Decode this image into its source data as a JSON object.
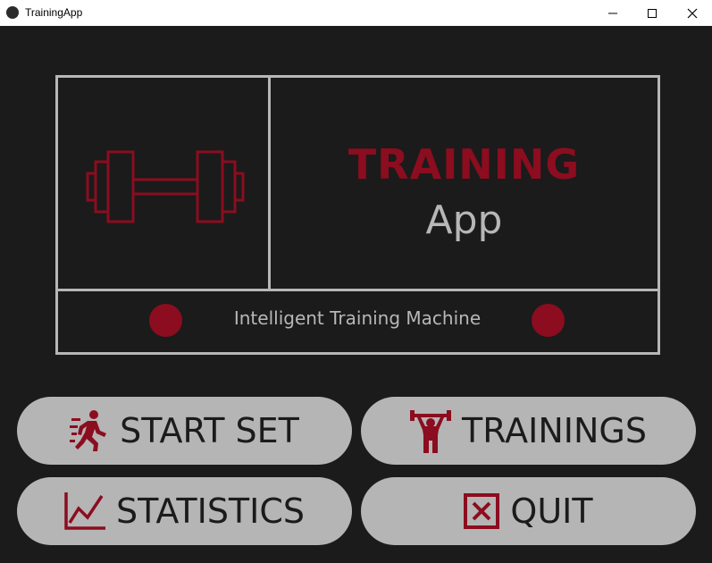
{
  "window": {
    "title": "TrainingApp",
    "controls": [
      "minimize",
      "maximize",
      "close"
    ]
  },
  "logo": {
    "title": "TRAINING",
    "subtitle": "App",
    "tagline": "Intelligent Training Machine",
    "icon": "dumbbell-icon"
  },
  "buttons": {
    "start_set": {
      "label": "START SET",
      "icon": "running-person-icon"
    },
    "trainings": {
      "label": "TRAININGS",
      "icon": "weightlifter-icon"
    },
    "statistics": {
      "label": "STATISTICS",
      "icon": "line-chart-icon"
    },
    "quit": {
      "label": "QUIT",
      "icon": "close-square-icon"
    }
  },
  "colors": {
    "background": "#1b1b1b",
    "accent": "#8b0d1f",
    "border": "#b7b7b7",
    "button": "#b5b5b5"
  }
}
